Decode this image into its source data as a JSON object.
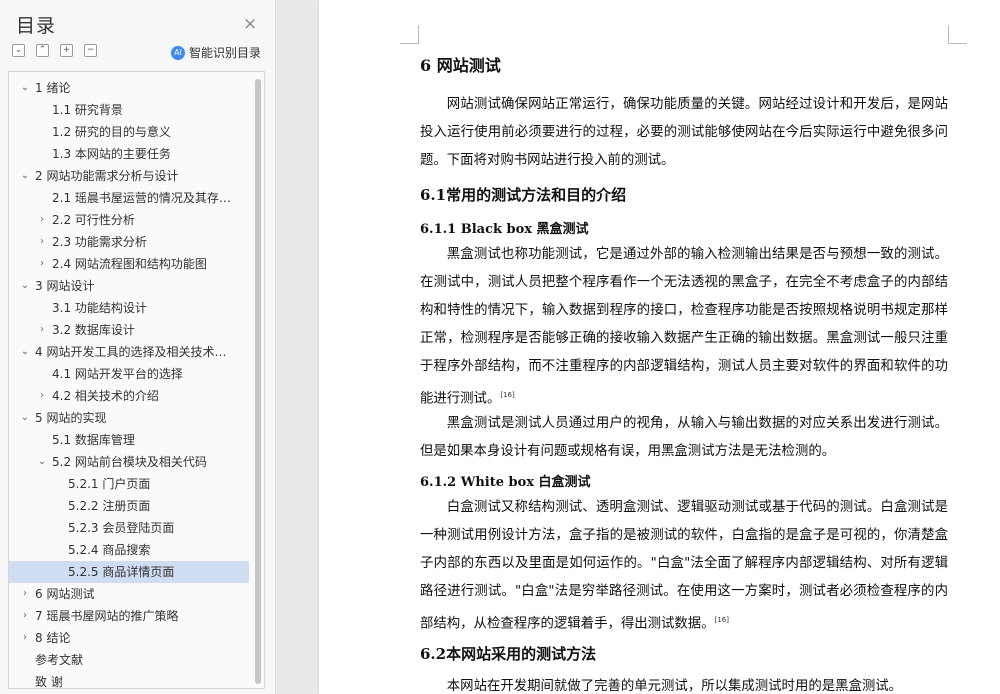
{
  "nav": {
    "title": "目录",
    "close_glyph": "×",
    "toolbar": {
      "expand_all_glyph": "⌄",
      "collapse_all_glyph": "⌃",
      "add_glyph": "+",
      "remove_glyph": "−",
      "smart_toc_label": "智能识别目录",
      "smart_toc_icon": "ai-icon"
    },
    "toc": [
      {
        "label": "1  绪论",
        "level": 1,
        "caret": "⌄"
      },
      {
        "label": "1.1 研究背景",
        "level": 2,
        "caret": ""
      },
      {
        "label": "1.2  研究的目的与意义",
        "level": 2,
        "caret": ""
      },
      {
        "label": "1.3  本网站的主要任务",
        "level": 2,
        "caret": ""
      },
      {
        "label": "2  网站功能需求分析与设计",
        "level": 1,
        "caret": "⌄"
      },
      {
        "label": "2.1  瑶晨书屋运营的情况及其存…",
        "level": 2,
        "caret": ""
      },
      {
        "label": "2.2  可行性分析",
        "level": 2,
        "caret": "›"
      },
      {
        "label": "2.3  功能需求分析",
        "level": 2,
        "caret": "›"
      },
      {
        "label": "2.4 网站流程图和结构功能图",
        "level": 2,
        "caret": "›"
      },
      {
        "label": "3  网站设计",
        "level": 1,
        "caret": "⌄"
      },
      {
        "label": "3.1 功能结构设计",
        "level": 2,
        "caret": ""
      },
      {
        "label": "3.2  数据库设计",
        "level": 2,
        "caret": "›"
      },
      {
        "label": "4  网站开发工具的选择及相关技术…",
        "level": 1,
        "caret": "⌄"
      },
      {
        "label": "4.1 网站开发平台的选择",
        "level": 2,
        "caret": ""
      },
      {
        "label": "4.2 相关技术的介绍",
        "level": 2,
        "caret": "›"
      },
      {
        "label": "5  网站的实现",
        "level": 1,
        "caret": "⌄"
      },
      {
        "label": "5.1  数据库管理",
        "level": 2,
        "caret": ""
      },
      {
        "label": "5.2  网站前台模块及相关代码",
        "level": 2,
        "caret": "⌄"
      },
      {
        "label": "5.2.1 门户页面",
        "level": 3,
        "caret": ""
      },
      {
        "label": "5.2.2  注册页面",
        "level": 3,
        "caret": ""
      },
      {
        "label": "5.2.3  会员登陆页面",
        "level": 3,
        "caret": ""
      },
      {
        "label": "5.2.4  商品搜索",
        "level": 3,
        "caret": ""
      },
      {
        "label": "5.2.5  商品详情页面",
        "level": 3,
        "caret": "",
        "selected": true
      },
      {
        "label": "6  网站测试",
        "level": 1,
        "caret": "›"
      },
      {
        "label": "7  瑶晨书屋网站的推广策略",
        "level": 1,
        "caret": "›"
      },
      {
        "label": "8  结论",
        "level": 1,
        "caret": "›"
      },
      {
        "label": "参考文献",
        "level": 0,
        "caret": ""
      },
      {
        "label": "致    谢",
        "level": 0,
        "caret": ""
      }
    ]
  },
  "doc": {
    "h1": "6  网站测试",
    "p1": "网站测试确保网站正常运行，确保功能质量的关键。网站经过设计和开发后，是网站投入运行使用前必须要进行的过程，必要的测试能够使网站在今后实际运行中避免很多问题。下面将对购书网站进行投入前的测试。",
    "h2_1": "6.1常用的测试方法和目的介绍",
    "h3_1": "6.1.1 Black box 黑盒测试",
    "p2": "黑盒测试也称功能测试，它是通过外部的输入检测输出结果是否与预想一致的测试。在测试中，测试人员把整个程序看作一个无法透视的黑盒子，在完全不考虑盒子的内部结构和特性的情况下，输入数据到程序的接口，检查程序功能是否按照规格说明书规定那样正常，检测程序是否能够正确的接收输入数据产生正确的输出数据。黑盒测试一般只注重于程序外部结构，而不注重程序的内部逻辑结构，测试人员主要对软件的界面和软件的功能进行测试。",
    "cite1": "[16]",
    "p3": "黑盒测试是测试人员通过用户的视角，从输入与输出数据的对应关系出发进行测试。但是如果本身设计有问题或规格有误，用黑盒测试方法是无法检测的。",
    "h3_2": "6.1.2 White box 白盒测试",
    "p4": "白盒测试又称结构测试、透明盒测试、逻辑驱动测试或基于代码的测试。白盒测试是一种测试用例设计方法，盒子指的是被测试的软件，白盒指的是盒子是可视的，你清楚盒子内部的东西以及里面是如何运作的。\"白盒\"法全面了解程序内部逻辑结构、对所有逻辑路径进行测试。\"白盒\"法是穷举路径测试。在使用这一方案时，测试者必须检查程序的内部结构，从检查程序的逻辑着手，得出测试数据。",
    "cite2": "[16]",
    "h2_2": "6.2本网站采用的测试方法",
    "p5": "本网站在开发期间就做了完善的单元测试，所以集成测试时用的是黑盒测试。"
  }
}
